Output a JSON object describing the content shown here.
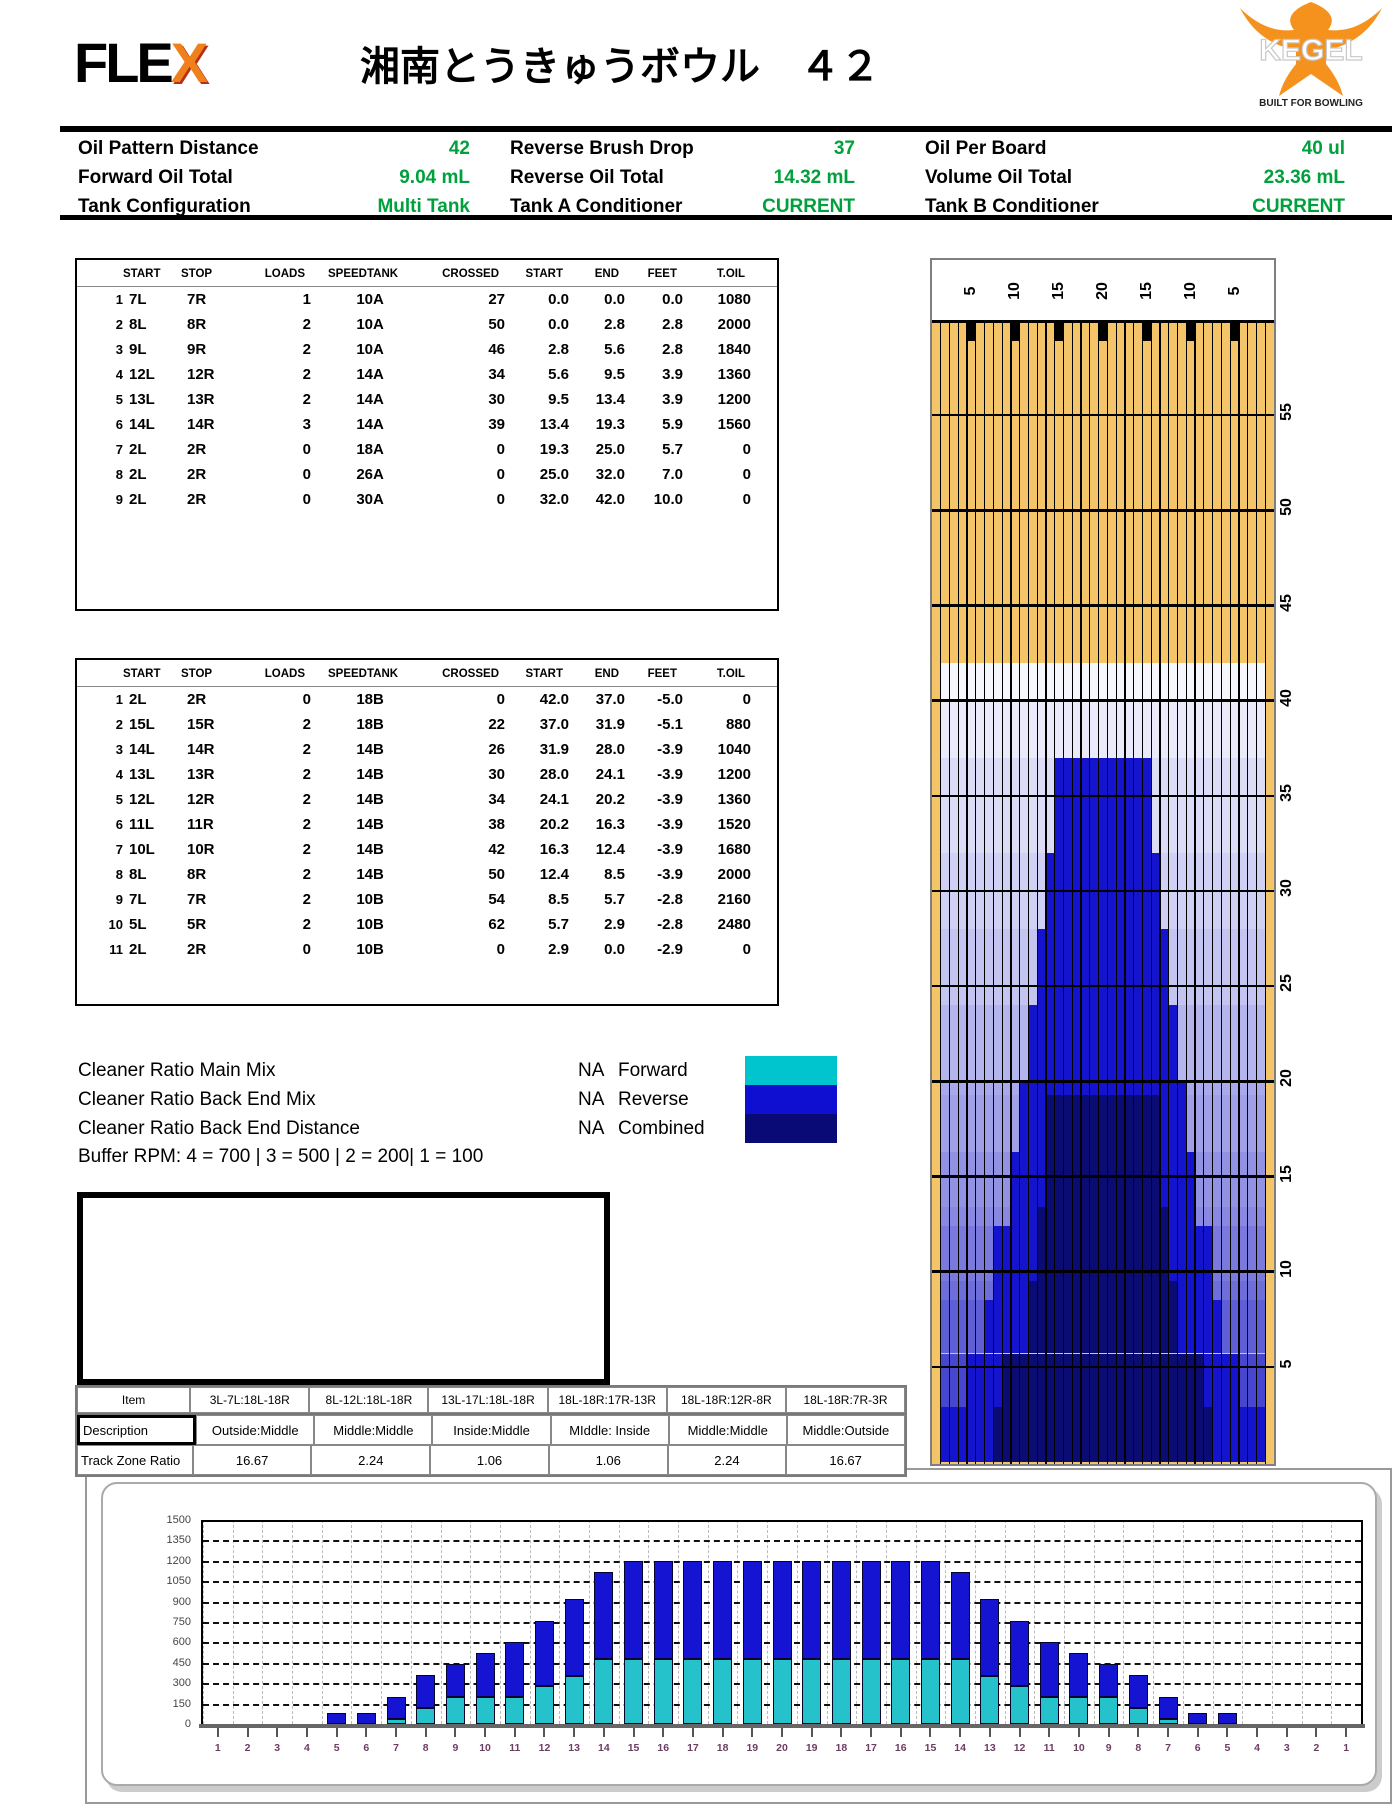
{
  "page_title": "湘南とうきゅうボウル　４２",
  "logos": {
    "flex": {
      "text": "FLE",
      "x": "X"
    },
    "kegel": {
      "name": "KEGEL",
      "tagline": "BUILT FOR BOWLING"
    }
  },
  "info": {
    "value_color": "#00A03C",
    "cells": [
      [
        "Oil Pattern Distance",
        "42"
      ],
      [
        "Reverse Brush Drop",
        "37"
      ],
      [
        "Oil Per Board",
        "40 ul"
      ],
      [
        "Forward Oil Total",
        "9.04 mL"
      ],
      [
        "Reverse Oil Total",
        "14.32 mL"
      ],
      [
        "Volume Oil Total",
        "23.36 mL"
      ],
      [
        "Tank Configuration",
        "Multi Tank"
      ],
      [
        "Tank A Conditioner",
        "CURRENT"
      ],
      [
        "Tank B Conditioner",
        "CURRENT"
      ]
    ]
  },
  "load_table": {
    "columns": [
      "",
      "START",
      "STOP",
      "LOADS",
      "SPEED",
      "TANK",
      "CROSSED",
      "START",
      "END",
      "FEET",
      "T.OIL"
    ],
    "forward": [
      [
        "1",
        "7L",
        "7R",
        "1",
        "10",
        "A",
        "27",
        "0.0",
        "0.0",
        "0.0",
        "1080"
      ],
      [
        "2",
        "8L",
        "8R",
        "2",
        "10",
        "A",
        "50",
        "0.0",
        "2.8",
        "2.8",
        "2000"
      ],
      [
        "3",
        "9L",
        "9R",
        "2",
        "10",
        "A",
        "46",
        "2.8",
        "5.6",
        "2.8",
        "1840"
      ],
      [
        "4",
        "12L",
        "12R",
        "2",
        "14",
        "A",
        "34",
        "5.6",
        "9.5",
        "3.9",
        "1360"
      ],
      [
        "5",
        "13L",
        "13R",
        "2",
        "14",
        "A",
        "30",
        "9.5",
        "13.4",
        "3.9",
        "1200"
      ],
      [
        "6",
        "14L",
        "14R",
        "3",
        "14",
        "A",
        "39",
        "13.4",
        "19.3",
        "5.9",
        "1560"
      ],
      [
        "7",
        "2L",
        "2R",
        "0",
        "18",
        "A",
        "0",
        "19.3",
        "25.0",
        "5.7",
        "0"
      ],
      [
        "8",
        "2L",
        "2R",
        "0",
        "26",
        "A",
        "0",
        "25.0",
        "32.0",
        "7.0",
        "0"
      ],
      [
        "9",
        "2L",
        "2R",
        "0",
        "30",
        "A",
        "0",
        "32.0",
        "42.0",
        "10.0",
        "0"
      ]
    ],
    "reverse": [
      [
        "1",
        "2L",
        "2R",
        "0",
        "18",
        "B",
        "0",
        "42.0",
        "37.0",
        "-5.0",
        "0"
      ],
      [
        "2",
        "15L",
        "15R",
        "2",
        "18",
        "B",
        "22",
        "37.0",
        "31.9",
        "-5.1",
        "880"
      ],
      [
        "3",
        "14L",
        "14R",
        "2",
        "14",
        "B",
        "26",
        "31.9",
        "28.0",
        "-3.9",
        "1040"
      ],
      [
        "4",
        "13L",
        "13R",
        "2",
        "14",
        "B",
        "30",
        "28.0",
        "24.1",
        "-3.9",
        "1200"
      ],
      [
        "5",
        "12L",
        "12R",
        "2",
        "14",
        "B",
        "34",
        "24.1",
        "20.2",
        "-3.9",
        "1360"
      ],
      [
        "6",
        "11L",
        "11R",
        "2",
        "14",
        "B",
        "38",
        "20.2",
        "16.3",
        "-3.9",
        "1520"
      ],
      [
        "7",
        "10L",
        "10R",
        "2",
        "14",
        "B",
        "42",
        "16.3",
        "12.4",
        "-3.9",
        "1680"
      ],
      [
        "8",
        "8L",
        "8R",
        "2",
        "14",
        "B",
        "50",
        "12.4",
        "8.5",
        "-3.9",
        "2000"
      ],
      [
        "9",
        "7L",
        "7R",
        "2",
        "10",
        "B",
        "54",
        "8.5",
        "5.7",
        "-2.8",
        "2160"
      ],
      [
        "10",
        "5L",
        "5R",
        "2",
        "10",
        "B",
        "62",
        "5.7",
        "2.9",
        "-2.8",
        "2480"
      ],
      [
        "11",
        "2L",
        "2R",
        "0",
        "10",
        "B",
        "0",
        "2.9",
        "0.0",
        "-2.9",
        "0"
      ]
    ]
  },
  "cleaner": {
    "rows": [
      [
        "Cleaner Ratio Main Mix",
        "NA"
      ],
      [
        "Cleaner Ratio Back End Mix",
        "NA"
      ],
      [
        "Cleaner Ratio Back End Distance",
        "NA"
      ]
    ],
    "legend": [
      [
        "Forward",
        "#00C5CE"
      ],
      [
        "Reverse",
        "#0F0FD2"
      ],
      [
        "Combined",
        "#0A0A77"
      ]
    ],
    "buffer_rpm": "Buffer RPM: 4 = 700 | 3 = 500 | 2 = 200| 1 = 100"
  },
  "track_zone": {
    "item_label": "Item",
    "col_headers": [
      "3L-7L:18L-18R",
      "8L-12L:18L-18R",
      "13L-17L:18L-18R",
      "18L-18R:17R-13R",
      "18L-18R:12R-8R",
      "18L-18R:7R-3R"
    ],
    "desc_label": "Description",
    "descriptions": [
      "Outside:Middle",
      "Middle:Middle",
      "Inside:Middle",
      "MIddle: Inside",
      "Middle:Middle",
      "Middle:Outside"
    ],
    "ratio_label": "Track Zone Ratio",
    "ratios": [
      "16.67",
      "2.24",
      "1.06",
      "1.06",
      "2.24",
      "16.67"
    ]
  },
  "chart_data": [
    {
      "type": "heatmap",
      "name": "lane-oil-pattern",
      "boards": 39,
      "length_ft": 60,
      "oil_end_ft": 42,
      "board_labels_top": [
        "5",
        "10",
        "15",
        "20",
        "15",
        "10",
        "5"
      ],
      "marker_boards": [
        5,
        10,
        15,
        20,
        25,
        30,
        35
      ],
      "distance_labels": [
        "55",
        "50",
        "45",
        "40",
        "35",
        "30",
        "25",
        "20",
        "15",
        "10",
        "5"
      ],
      "colors": {
        "dry": "#F4C469",
        "mid": "#1414CE",
        "inner": "#0B0B74"
      },
      "bands": [
        [
          42,
          40,
          "#F6F6FD",
          null,
          null,
          null,
          null
        ],
        [
          40,
          37,
          "#EAEAFA",
          null,
          null,
          null,
          null
        ],
        [
          37,
          32,
          "#DCDCF7",
          15,
          25,
          null,
          null
        ],
        [
          32,
          28,
          "#D0D0F4",
          14,
          26,
          null,
          null
        ],
        [
          28,
          24,
          "#C4C4F1",
          13,
          27,
          null,
          null
        ],
        [
          24,
          20,
          "#B5B5ED",
          12,
          28,
          null,
          null
        ],
        [
          20,
          19.3,
          "#A8A8EA",
          11,
          29,
          null,
          null
        ],
        [
          19.3,
          16.3,
          "#A0A0E8",
          11,
          29,
          14,
          26
        ],
        [
          16.3,
          13.4,
          "#9292E5",
          10,
          30,
          14,
          26
        ],
        [
          13.4,
          12.4,
          "#8888E2",
          10,
          30,
          13,
          27
        ],
        [
          12.4,
          9.5,
          "#7A7ADE",
          8,
          32,
          13,
          27
        ],
        [
          9.5,
          8.5,
          "#6E6EDB",
          8,
          32,
          12,
          28
        ],
        [
          8.5,
          5.7,
          "#5E5ED7",
          7,
          33,
          12,
          28
        ],
        [
          5.7,
          2.9,
          "#4646D0",
          5,
          35,
          9,
          31
        ],
        [
          2.9,
          0,
          "#2C2CC9",
          2,
          38,
          8,
          32
        ]
      ]
    },
    {
      "type": "bar",
      "stacked": true,
      "title": "",
      "xlabel": "",
      "ylabel": "",
      "ylim": [
        0,
        1500
      ],
      "ytick": 150,
      "ytick_labels": [
        "0",
        "150",
        "300",
        "450",
        "600",
        "750",
        "900",
        "1050",
        "1200",
        "1350",
        "1500"
      ],
      "categories": [
        "1",
        "2",
        "3",
        "4",
        "5",
        "6",
        "7",
        "8",
        "9",
        "10",
        "11",
        "12",
        "13",
        "14",
        "15",
        "16",
        "17",
        "18",
        "19",
        "20",
        "19",
        "18",
        "17",
        "16",
        "15",
        "14",
        "13",
        "12",
        "11",
        "10",
        "9",
        "8",
        "7",
        "6",
        "5",
        "4",
        "3",
        "2",
        "1"
      ],
      "series": [
        {
          "name": "Forward",
          "color": "#25C2CC",
          "values": [
            0,
            0,
            0,
            0,
            0,
            0,
            40,
            120,
            200,
            200,
            200,
            280,
            350,
            480,
            480,
            480,
            480,
            480,
            480,
            480,
            480,
            480,
            480,
            480,
            480,
            480,
            350,
            280,
            200,
            200,
            200,
            120,
            40,
            0,
            0,
            0,
            0,
            0,
            0
          ]
        },
        {
          "name": "Reverse",
          "color": "#1414D2",
          "values": [
            0,
            0,
            0,
            0,
            80,
            80,
            160,
            240,
            240,
            320,
            400,
            480,
            570,
            640,
            720,
            720,
            720,
            720,
            720,
            720,
            720,
            720,
            720,
            720,
            720,
            640,
            570,
            480,
            400,
            320,
            240,
            240,
            160,
            80,
            80,
            0,
            0,
            0,
            0
          ]
        }
      ]
    }
  ]
}
